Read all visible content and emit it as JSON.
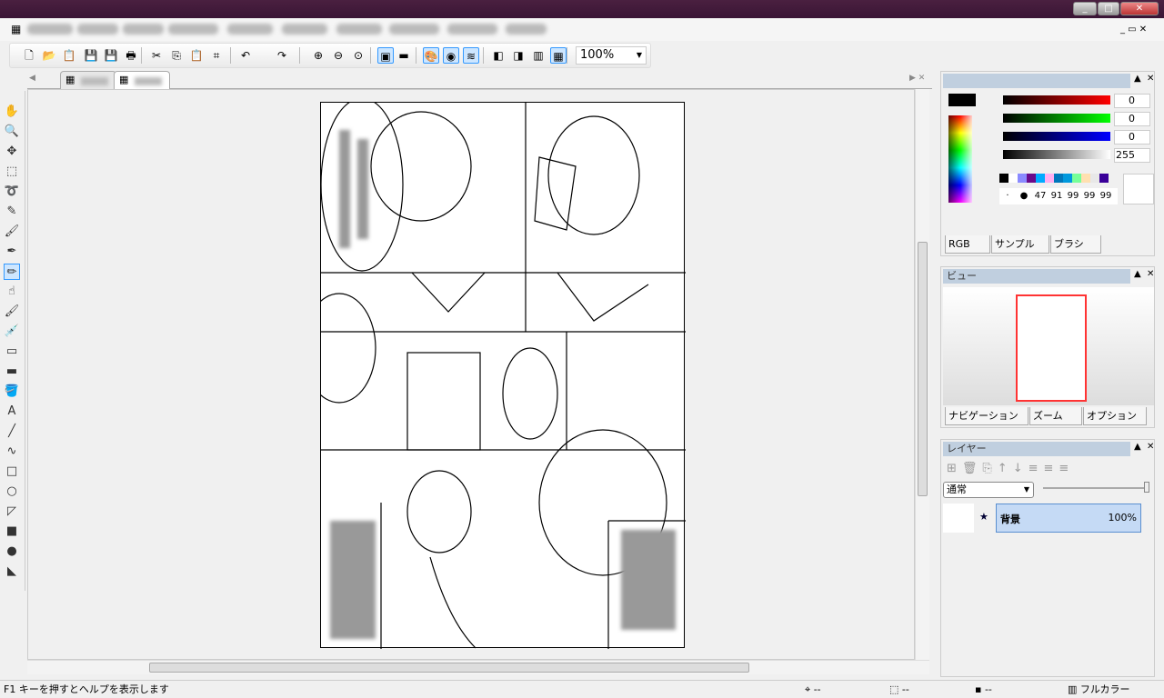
{
  "window": {
    "controls": [
      "minimize",
      "maximize",
      "close"
    ]
  },
  "toolbar": {
    "zoom": "100%",
    "icons": [
      "new-icon",
      "open-icon",
      "paste-new-icon",
      "save-icon",
      "save-all-icon",
      "print-icon",
      "cut-icon",
      "copy-icon",
      "paste-icon",
      "crop-icon",
      "undo-icon",
      "redo-icon",
      "zoom-in-icon",
      "zoom-out-icon",
      "zoom-fit-icon",
      "image-icon",
      "ruler-icon",
      "palette-icon",
      "navigator-icon",
      "layers-icon",
      "mono-icon",
      "gray-icon",
      "color-levels-icon",
      "fullcolor-icon"
    ]
  },
  "color_panel": {
    "r": "0",
    "g": "0",
    "b": "0",
    "a": "255",
    "tabs": [
      "RGB",
      "サンプル",
      "ブラシ"
    ],
    "swatches": [
      "#000000",
      "#ffffff",
      "#8a8aff",
      "#6a0a8a",
      "#00aaff",
      "#ffb0f0",
      "#0077bb",
      "#0099dd",
      "#77ff99",
      "#ffe0b0",
      "#e8e8e8",
      "#3a0099"
    ],
    "brush_sizes": [
      "·",
      "●",
      "47",
      "91",
      "99",
      "99",
      "99"
    ]
  },
  "view_panel": {
    "title": "ビュー",
    "tabs": [
      "ナビゲーション",
      "ズーム",
      "オプション"
    ]
  },
  "layer_panel": {
    "title": "レイヤー",
    "blend_mode": "通常",
    "layers": [
      {
        "name": "背景",
        "opacity": "100%"
      }
    ]
  },
  "statusbar": {
    "help": "F1 キーを押すとヘルプを表示します",
    "pos": "--",
    "size": "--",
    "color": "--",
    "mode": "フルカラー"
  }
}
